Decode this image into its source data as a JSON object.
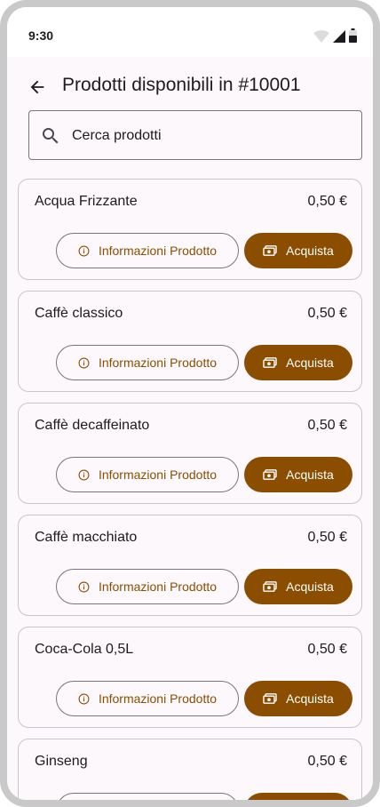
{
  "status_bar": {
    "time": "9:30",
    "icons": [
      "wifi-icon",
      "signal-icon",
      "battery-icon"
    ]
  },
  "app_bar": {
    "back_icon": "arrow-back-icon",
    "title": "Prodotti disponibili in #10001"
  },
  "search": {
    "icon": "search-icon",
    "placeholder": "Cerca prodotti",
    "value": ""
  },
  "buttons": {
    "info_label": "Informazioni Prodotto",
    "info_icon": "info-icon",
    "buy_label": "Acquista",
    "buy_icon": "payments-icon"
  },
  "products": [
    {
      "name": "Acqua Frizzante",
      "price": "0,50 €"
    },
    {
      "name": "Caffè classico",
      "price": "0,50 €"
    },
    {
      "name": "Caffè decaffeinato",
      "price": "0,50 €"
    },
    {
      "name": "Caffè macchiato",
      "price": "0,50 €"
    },
    {
      "name": "Coca-Cola 0,5L",
      "price": "0,50 €"
    },
    {
      "name": "Ginseng",
      "price": "0,50 €"
    }
  ],
  "colors": {
    "primary": "#8b4e00",
    "background": "#fdf8fb",
    "outline": "#79747e",
    "card_outline": "#cac4d0",
    "text": "#1c1b1f"
  }
}
